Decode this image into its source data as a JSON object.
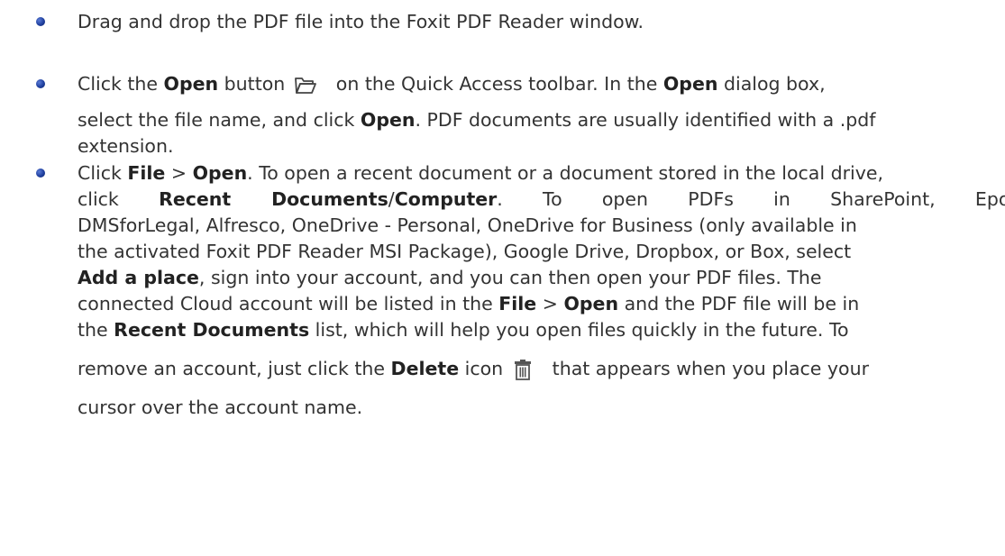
{
  "b1": {
    "t1": "Drag and drop the PDF file into the Foxit PDF Reader window."
  },
  "b2": {
    "a": "Click the ",
    "b": "Open",
    "c": " button",
    "d": " on the Quick Access toolbar. In the ",
    "e": "Open",
    "f": " dialog box,",
    "g": "select the file name, and click ",
    "h": "Open",
    "i": ". PDF documents are usually identified with a .pdf",
    "j": "extension."
  },
  "b3": {
    "a": "Click ",
    "b": "File",
    "c": " > ",
    "d": "Open",
    "e": ". To open a recent document or a document stored in the local drive,",
    "f": "click ",
    "g": "Recent Documents",
    "h": "/",
    "i": "Computer",
    "j": ". To open PDFs in SharePoint, Epona",
    "k": "DMSforLegal, Alfresco, OneDrive - Personal, OneDrive for Business (only available in",
    "l": "the activated Foxit PDF Reader MSI Package), Google Drive, Dropbox, or Box, select",
    "m": "Add a place",
    "n": ", sign into your account, and you can then open your PDF files. The",
    "o": "connected Cloud account will be listed in the ",
    "p": "File",
    "q": " > ",
    "r": "Open",
    "s": " and the PDF file will be in",
    "t": "the ",
    "u": "Recent Documents",
    "v": " list, which will help you open files quickly in the future. To",
    "w": "remove an account, just click the ",
    "x": "Delete",
    "y": " icon",
    "z": " that appears when you place your",
    "aa": "cursor over the account name."
  },
  "icons": {
    "open": "folder-open-icon",
    "delete": "trash-delete-icon"
  }
}
